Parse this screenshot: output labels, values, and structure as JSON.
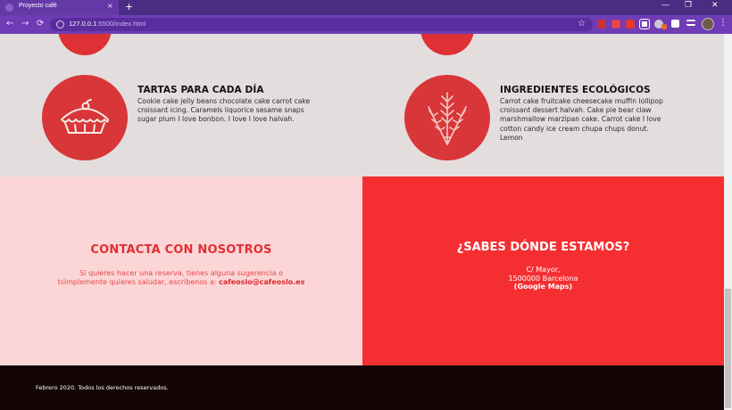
{
  "browser": {
    "tab_title": "Proyecto café",
    "tab_close": "×",
    "new_tab": "+",
    "minimize": "—",
    "maximize": "❐",
    "close": "✕",
    "back": "←",
    "forward": "→",
    "reload": "⟳",
    "url_host": "127.0.0.1",
    "url_path": ":5500/index.html",
    "star": "☆",
    "menu": "⋮",
    "colors": {
      "tabbar": "#4a2c82",
      "toolbar": "#6f3cb5"
    },
    "extensions": [
      "pdf-extension-icon",
      "pocket-icon",
      "acrobat-icon",
      "screenshot-icon",
      "vpn-icon",
      "color-picker-icon",
      "puzzle-icon",
      "reading-list-icon"
    ]
  },
  "features": [
    {
      "title": "TARTAS PARA CADA DÍA",
      "text_lines": [
        "Cookie cake jelly beans chocolate cake carrot cake",
        "croissant icing. Caramels liquorice sesame snaps",
        "sugar plum I love bonbon. I love I love halvah."
      ],
      "icon": "pie-icon"
    },
    {
      "title": "INGREDIENTES ECOLÓGICOS",
      "text_lines": [
        "Carrot cake fruitcake cheesecake muffin lollipop",
        "croissant dessert halvah. Cake pie bear claw",
        "marshmallow marzipan cake. Carrot cake I love",
        "cotton candy ice cream chupa chups donut.",
        "Lemon"
      ],
      "icon": "wheat-icon"
    }
  ],
  "contact": {
    "title": "CONTACTA CON NOSOTROS",
    "line1": "Si quieres hacer una reserva, tienes alguna sugerencia o",
    "line2": "tsimplemente quieres saludar, escríbenos a:",
    "email": "cafeoslo@cafeoslo.es"
  },
  "location": {
    "title": "¿SABES DÓNDE ESTAMOS?",
    "street": "C/ Mayor,",
    "city": "1500000 Barcelona",
    "map_link": "(Google Maps)"
  },
  "footer": {
    "text": "Febrero 2020. Todos los derechos reservados."
  },
  "colors": {
    "accent": "#d9363a",
    "contact_bg": "#fcd6d6",
    "location_bg": "#f52e32",
    "footer_bg": "#150606",
    "features_bg": "#e3dedd"
  }
}
